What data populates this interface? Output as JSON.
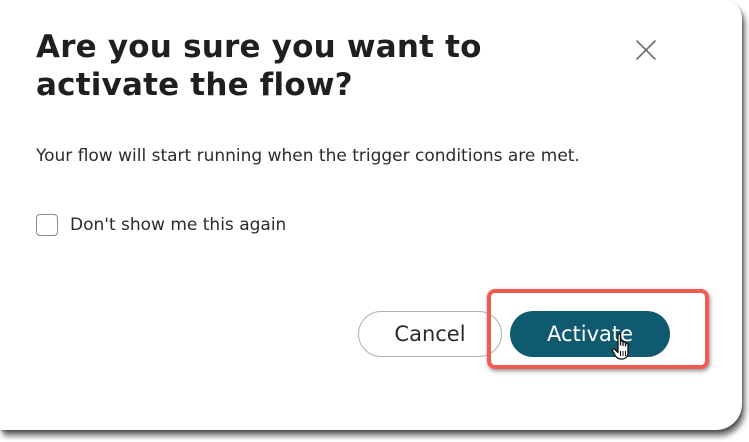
{
  "dialog": {
    "title": "Are you sure you want to activate the flow?",
    "message": "Your flow will start running when the trigger conditions are met.",
    "close_icon": "close-icon",
    "checkbox": {
      "label": "Don't show me this again",
      "checked": false
    },
    "buttons": {
      "cancel_label": "Cancel",
      "activate_label": "Activate"
    }
  },
  "colors": {
    "primary": "#0f5a6e",
    "highlight": "#f05a4f",
    "text": "#1f1f1f"
  },
  "cursor_icon": "hand-pointer-icon"
}
